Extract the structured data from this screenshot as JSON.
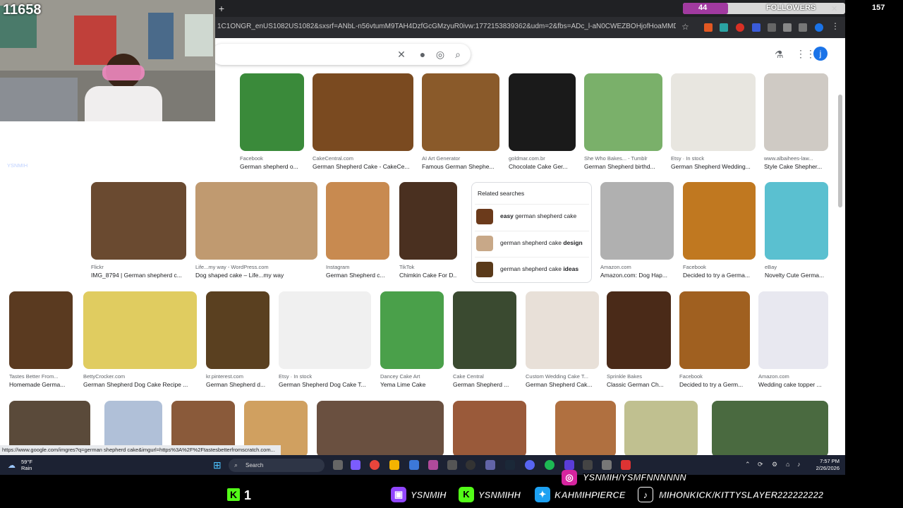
{
  "browser": {
    "new_tab": "+",
    "url": "1C1ONGR_enUS1082US1082&sxsrf=ANbL-n56vtumM9TAH4DzfGcGMzyuR0ivw:1772153839362&udm=2&fbs=ADc_l-aN0CWEZBOHjofHoaMMDiKpV6Bbbmx4QVaoKk...",
    "account_initial": "j",
    "status_url": "https://www.google.com/imgres?q=german shepherd cake&imgurl=https%3A%2F%2Ftastesbetterfromscratch.com..."
  },
  "search": {
    "clear_icon": "close-icon",
    "mic_icon": "mic-icon",
    "lens_icon": "lens-icon",
    "search_icon": "search-icon"
  },
  "images": {
    "row1": [
      {
        "source": "Facebook",
        "caption": "German shepherd o...",
        "color": "#3a8a3a"
      },
      {
        "source": "CakeCentral.com",
        "caption": "German Shepherd Cake - CakeCe...",
        "color": "#7a4a20"
      },
      {
        "source": "AI Art Generator",
        "caption": "Famous German Shephe...",
        "color": "#8a5a2a"
      },
      {
        "source": "goldmar.com.br",
        "caption": "Chocolate Cake Ger...",
        "color": "#1a1a1a"
      },
      {
        "source": "She Who Bakes... - Tumblr",
        "caption": "German Shepherd birthd...",
        "color": "#7ab06a"
      },
      {
        "source": "Etsy · In stock",
        "caption": "German Shepherd Wedding...",
        "color": "#e8e6e0"
      },
      {
        "source": "www.albaihees-law...",
        "caption": "Style Cake Shepher...",
        "color": "#cfcac4"
      }
    ],
    "row2": [
      {
        "source": "Flickr",
        "caption": "IMG_8794 | German shepherd c...",
        "color": "#6a4a30"
      },
      {
        "source": "Life...my way - WordPress.com",
        "caption": "Dog shaped cake – Life...my way",
        "color": "#c09a70"
      },
      {
        "source": "Instagram",
        "caption": "German Shepherd c...",
        "color": "#c88a50"
      },
      {
        "source": "TikTok",
        "caption": "Chimkin Cake For D...",
        "color": "#4a3020"
      },
      {
        "source": "Amazon.com",
        "caption": "Amazon.com: Dog Hap...",
        "color": "#b0b0b0"
      },
      {
        "source": "Facebook",
        "caption": "Decided to try a Germa...",
        "color": "#c07820"
      },
      {
        "source": "eBay",
        "caption": "Novelty Cute Germa...",
        "color": "#5ac0d0"
      }
    ],
    "row3": [
      {
        "source": "Tastes Better From...",
        "caption": "Homemade Germa...",
        "color": "#5a3a20"
      },
      {
        "source": "BettyCrocker.com",
        "caption": "German Shepherd Dog Cake Recipe ...",
        "color": "#e0cc60"
      },
      {
        "source": "kr.pinterest.com",
        "caption": "German Shepherd d...",
        "color": "#5a4020"
      },
      {
        "source": "Etsy · In stock",
        "caption": "German Shepherd Dog Cake T...",
        "color": "#f0f0f0"
      },
      {
        "source": "Dancey Cake Art",
        "caption": "Yema Lime Cake",
        "color": "#4aa04a"
      },
      {
        "source": "Cake Central",
        "caption": "German Shepherd ...",
        "color": "#3a4a30"
      },
      {
        "source": "Custom Wedding Cake T...",
        "caption": "German Shepherd Cak...",
        "color": "#e8e0d8"
      },
      {
        "source": "Sprinkle Bakes",
        "caption": "Classic German Ch...",
        "color": "#4a2a18"
      },
      {
        "source": "Facebook",
        "caption": "Decided to try a Germ...",
        "color": "#a06020"
      },
      {
        "source": "Amazon.com",
        "caption": "Wedding cake topper ...",
        "color": "#e8e8f0"
      }
    ]
  },
  "related": {
    "title": "Related searches",
    "items": [
      {
        "prefix": "easy",
        "rest": " german shepherd cake",
        "bold_first": true
      },
      {
        "prefix": "german shepherd cake ",
        "rest": "design",
        "bold_first": false
      },
      {
        "prefix": "german shepherd cake ",
        "rest": "ideas",
        "bold_first": false
      }
    ]
  },
  "taskbar": {
    "temp": "59°F",
    "condition": "Rain",
    "search_placeholder": "Search",
    "time": "7:57 PM",
    "date": "2/26/2026"
  },
  "overlay": {
    "viewer_count": "11658",
    "followers_current": "44",
    "followers_label": "FOLLOWERS",
    "followers_goal": "157",
    "followers_progress": 0.28,
    "kick_count": "1",
    "socials": {
      "twitch": "YSNMIH",
      "kick": "YSNMIHH",
      "twitter": "KAHMIHPIERCE",
      "instagram": "YSNMIH/YSMFNNNNNN",
      "tiktok": "MIHONKICK/KITTYSLAYER222222222"
    }
  }
}
